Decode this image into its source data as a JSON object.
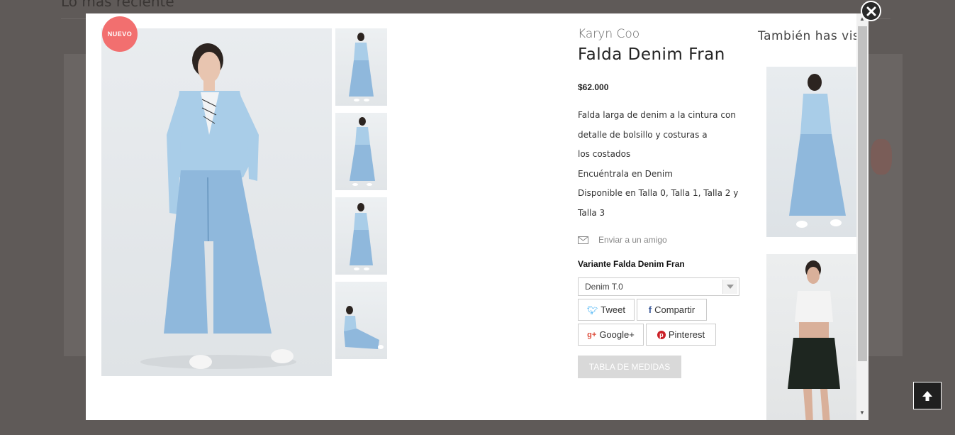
{
  "background": {
    "heading": "Lo más reciente"
  },
  "badge": "NUEVO",
  "product": {
    "brand": "Karyn Coo",
    "title": "Falda Denim Fran",
    "price": "$62.000",
    "description": [
      "Falda larga de denim a la cintura con",
      "detalle de bolsillo y costuras a",
      "los costados",
      "Encuéntrala en Denim",
      "Disponible en Talla 0, Talla 1, Talla 2 y",
      "Talla 3"
    ],
    "send_friend": "Enviar a un amigo",
    "variant_label": "Variante Falda Denim Fran",
    "variant_selected": "Denim T.0"
  },
  "share": {
    "tweet": "Tweet",
    "facebook": "Compartir",
    "google": "Google+",
    "pinterest": "Pinterest"
  },
  "size_table": "TABLA DE MEDIDAS",
  "also_seen": {
    "title": "También has visto"
  },
  "icons": {
    "close": "close-icon",
    "envelope": "envelope-icon",
    "back_to_top": "arrow-up-icon"
  },
  "colors": {
    "badge": "#f26f6f",
    "overlay": "#5f5a58",
    "denim": "#8fb8dc"
  }
}
